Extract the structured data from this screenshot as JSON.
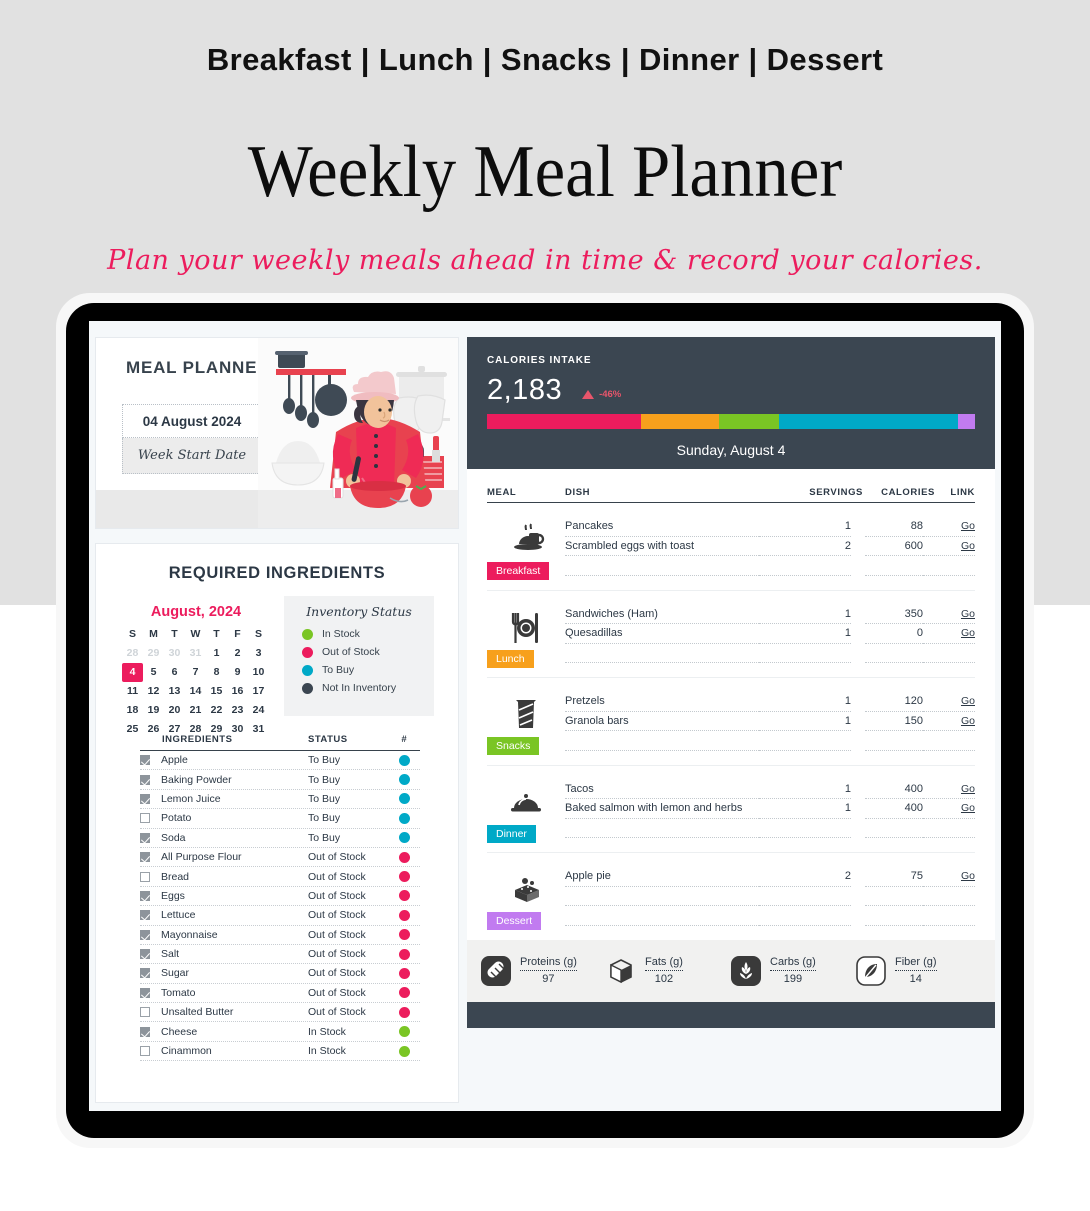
{
  "hero": {
    "eyebrow": "Breakfast | Lunch | Snacks | Dinner | Dessert",
    "title": "Weekly Meal Planner",
    "subtitle": "Plan your weekly meals ahead in time & record your calories."
  },
  "planner": {
    "title": "MEAL PLANNER",
    "date_value": "04 August 2024",
    "date_label": "Week Start Date"
  },
  "ingredients_panel": {
    "title": "REQUIRED INGREDIENTS",
    "calendar": {
      "month": "August, 2024",
      "dow": [
        "S",
        "M",
        "T",
        "W",
        "T",
        "F",
        "S"
      ],
      "weeks": [
        [
          {
            "d": "28",
            "muted": true
          },
          {
            "d": "29",
            "muted": true
          },
          {
            "d": "30",
            "muted": true
          },
          {
            "d": "31",
            "muted": true
          },
          {
            "d": "1"
          },
          {
            "d": "2"
          },
          {
            "d": "3"
          }
        ],
        [
          {
            "d": "4",
            "sel": true
          },
          {
            "d": "5"
          },
          {
            "d": "6"
          },
          {
            "d": "7"
          },
          {
            "d": "8"
          },
          {
            "d": "9"
          },
          {
            "d": "10"
          }
        ],
        [
          {
            "d": "11"
          },
          {
            "d": "12"
          },
          {
            "d": "13"
          },
          {
            "d": "14"
          },
          {
            "d": "15"
          },
          {
            "d": "16"
          },
          {
            "d": "17"
          }
        ],
        [
          {
            "d": "18"
          },
          {
            "d": "19"
          },
          {
            "d": "20"
          },
          {
            "d": "21"
          },
          {
            "d": "22"
          },
          {
            "d": "23"
          },
          {
            "d": "24"
          }
        ],
        [
          {
            "d": "25"
          },
          {
            "d": "26"
          },
          {
            "d": "27"
          },
          {
            "d": "28"
          },
          {
            "d": "29"
          },
          {
            "d": "30"
          },
          {
            "d": "31"
          }
        ]
      ],
      "selected_day": "4"
    },
    "inventory_status": {
      "title": "Inventory Status",
      "legend": [
        {
          "label": "In Stock",
          "color": "#7ac524"
        },
        {
          "label": "Out of Stock",
          "color": "#ec1c5d"
        },
        {
          "label": "To Buy",
          "color": "#00a9c7"
        },
        {
          "label": "Not In Inventory",
          "color": "#3b4651"
        }
      ]
    },
    "table": {
      "columns": [
        "INGREDIENTS",
        "STATUS",
        "#"
      ],
      "rows": [
        {
          "checked": true,
          "name": "Apple",
          "status": "To Buy",
          "color": "#00a9c7"
        },
        {
          "checked": true,
          "name": "Baking Powder",
          "status": "To Buy",
          "color": "#00a9c7"
        },
        {
          "checked": true,
          "name": "Lemon Juice",
          "status": "To Buy",
          "color": "#00a9c7"
        },
        {
          "checked": false,
          "name": "Potato",
          "status": "To Buy",
          "color": "#00a9c7"
        },
        {
          "checked": true,
          "name": "Soda",
          "status": "To Buy",
          "color": "#00a9c7"
        },
        {
          "checked": true,
          "name": "All Purpose Flour",
          "status": "Out of Stock",
          "color": "#ec1c5d"
        },
        {
          "checked": false,
          "name": "Bread",
          "status": "Out of Stock",
          "color": "#ec1c5d"
        },
        {
          "checked": true,
          "name": "Eggs",
          "status": "Out of Stock",
          "color": "#ec1c5d"
        },
        {
          "checked": true,
          "name": "Lettuce",
          "status": "Out of Stock",
          "color": "#ec1c5d"
        },
        {
          "checked": true,
          "name": "Mayonnaise",
          "status": "Out of Stock",
          "color": "#ec1c5d"
        },
        {
          "checked": true,
          "name": "Salt",
          "status": "Out of Stock",
          "color": "#ec1c5d"
        },
        {
          "checked": true,
          "name": "Sugar",
          "status": "Out of Stock",
          "color": "#ec1c5d"
        },
        {
          "checked": true,
          "name": "Tomato",
          "status": "Out of Stock",
          "color": "#ec1c5d"
        },
        {
          "checked": false,
          "name": "Unsalted Butter",
          "status": "Out of Stock",
          "color": "#ec1c5d"
        },
        {
          "checked": true,
          "name": "Cheese",
          "status": "In Stock",
          "color": "#7ac524"
        },
        {
          "checked": false,
          "name": "Cinammon",
          "status": "In Stock",
          "color": "#7ac524"
        }
      ]
    }
  },
  "calories_header": {
    "label": "CALORIES INTAKE",
    "total": "2,183",
    "delta": "-46%",
    "delta_color": "#e8556b",
    "date": "Sunday, August 4"
  },
  "chart_data": {
    "type": "bar",
    "title": "Calories Intake",
    "orientation": "horizontal-stacked",
    "total": 2183,
    "categories": [
      "Breakfast",
      "Lunch",
      "Snacks",
      "Dinner",
      "Dessert"
    ],
    "values": [
      688,
      350,
      270,
      800,
      75
    ],
    "colors": [
      "#ec1c5d",
      "#f7a01c",
      "#7ac524",
      "#00a9c7",
      "#c17bf0"
    ],
    "percentages": [
      31.5,
      16.0,
      12.4,
      36.6,
      3.4
    ],
    "xlabel": "",
    "ylabel": "",
    "legend": "none",
    "grid": false
  },
  "meal_table": {
    "columns": [
      "MEAL",
      "DISH",
      "SERVINGS",
      "CALORIES",
      "LINK"
    ],
    "link_label": "Go",
    "blocks": [
      {
        "meal": "Breakfast",
        "color": "#ec1c5d",
        "icon": "breakfast-icon",
        "dishes": [
          {
            "dish": "Pancakes",
            "servings": "1",
            "calories": "88",
            "link": "Go"
          },
          {
            "dish": "Scrambled eggs with toast",
            "servings": "2",
            "calories": "600",
            "link": "Go"
          },
          {
            "dish": "",
            "servings": "",
            "calories": "",
            "link": ""
          }
        ]
      },
      {
        "meal": "Lunch",
        "color": "#f7a01c",
        "icon": "lunch-icon",
        "dishes": [
          {
            "dish": "Sandwiches (Ham)",
            "servings": "1",
            "calories": "350",
            "link": "Go"
          },
          {
            "dish": "Quesadillas",
            "servings": "1",
            "calories": "0",
            "link": "Go"
          },
          {
            "dish": "",
            "servings": "",
            "calories": "",
            "link": ""
          }
        ]
      },
      {
        "meal": "Snacks",
        "color": "#7ac524",
        "icon": "snacks-icon",
        "dishes": [
          {
            "dish": "Pretzels",
            "servings": "1",
            "calories": "120",
            "link": "Go"
          },
          {
            "dish": "Granola bars",
            "servings": "1",
            "calories": "150",
            "link": "Go"
          },
          {
            "dish": "",
            "servings": "",
            "calories": "",
            "link": ""
          }
        ]
      },
      {
        "meal": "Dinner",
        "color": "#00a9c7",
        "icon": "dinner-icon",
        "dishes": [
          {
            "dish": "Tacos",
            "servings": "1",
            "calories": "400",
            "link": "Go"
          },
          {
            "dish": "Baked salmon with lemon and herbs",
            "servings": "1",
            "calories": "400",
            "link": "Go"
          },
          {
            "dish": "",
            "servings": "",
            "calories": "",
            "link": ""
          }
        ]
      },
      {
        "meal": "Dessert",
        "color": "#c17bf0",
        "icon": "dessert-icon",
        "dishes": [
          {
            "dish": "Apple pie",
            "servings": "2",
            "calories": "75",
            "link": "Go"
          },
          {
            "dish": "",
            "servings": "",
            "calories": "",
            "link": ""
          },
          {
            "dish": "",
            "servings": "",
            "calories": "",
            "link": ""
          }
        ]
      }
    ]
  },
  "macros": [
    {
      "label": "Proteins (g)",
      "value": "97",
      "icon": "protein-icon"
    },
    {
      "label": "Fats (g)",
      "value": "102",
      "icon": "fats-icon"
    },
    {
      "label": "Carbs (g)",
      "value": "199",
      "icon": "carbs-icon"
    },
    {
      "label": "Fiber (g)",
      "value": "14",
      "icon": "fiber-icon"
    }
  ]
}
